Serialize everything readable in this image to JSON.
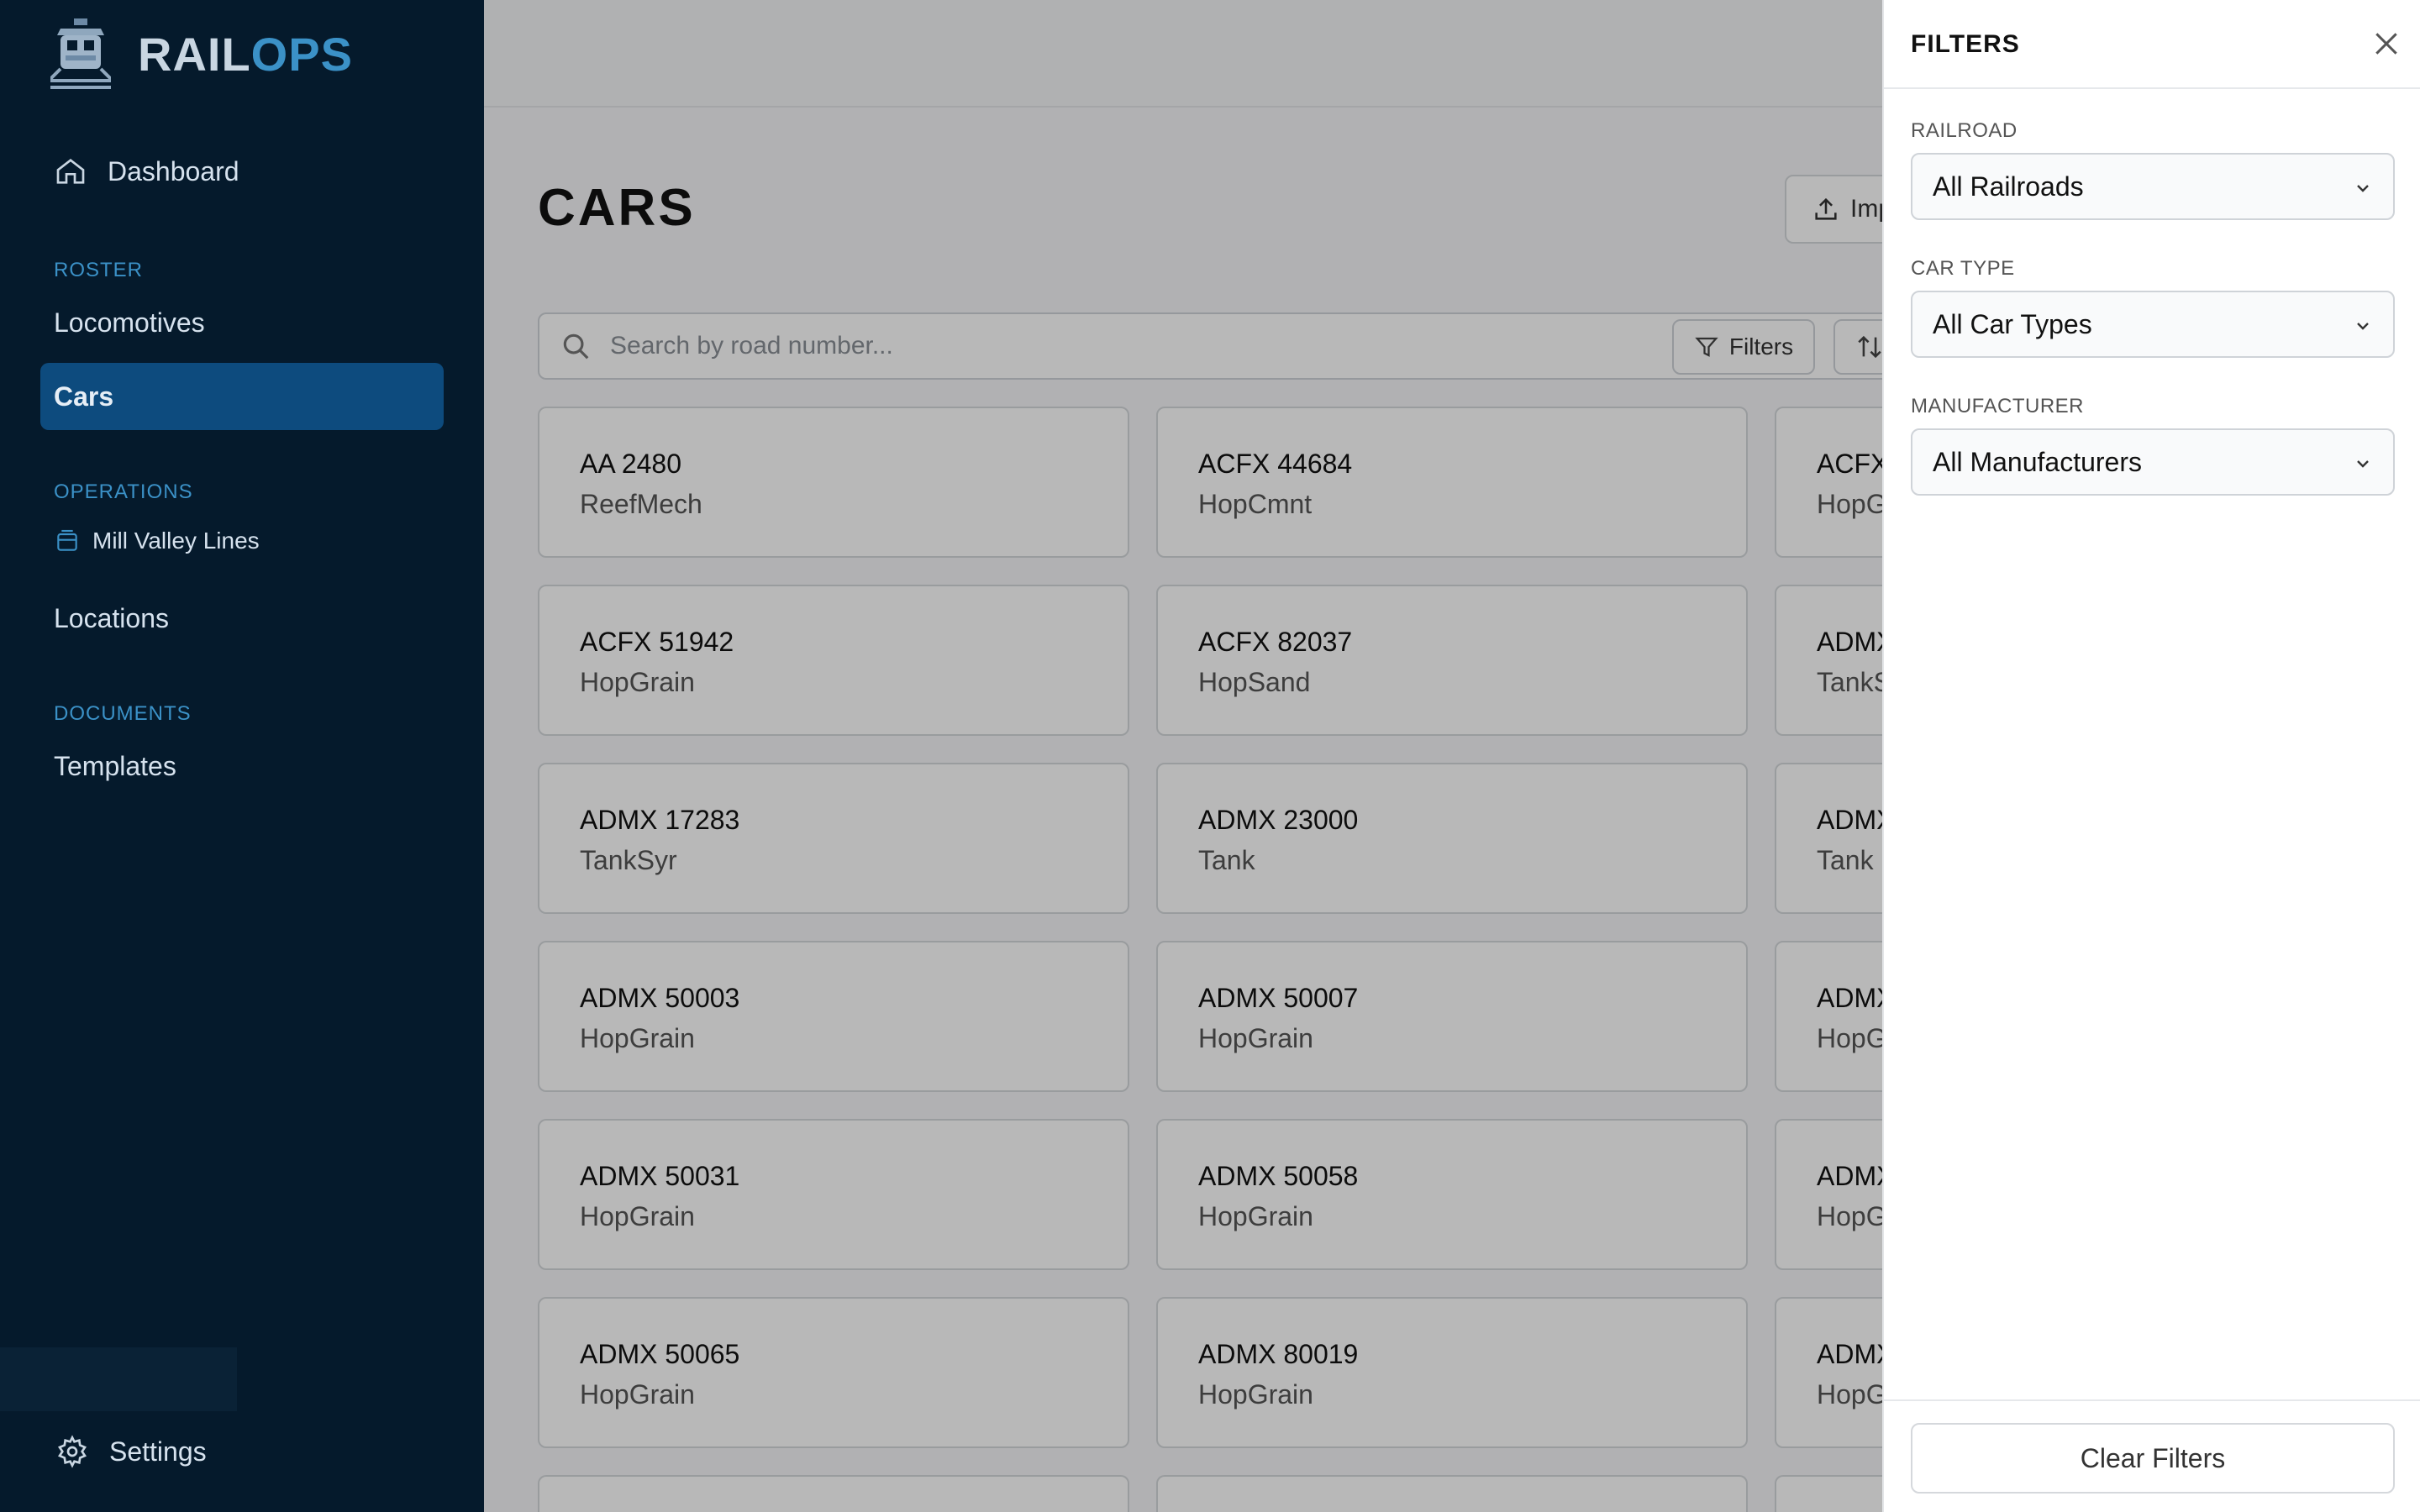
{
  "brand": {
    "part1": "RAIL",
    "part2": "OPS"
  },
  "sidebar": {
    "dashboard": "Dashboard",
    "roster_label": "ROSTER",
    "locomotives": "Locomotives",
    "cars": "Cars",
    "operations_label": "OPERATIONS",
    "layout": "Mill Valley Lines",
    "locations": "Locations",
    "documents_label": "DOCUMENTS",
    "templates": "Templates",
    "settings": "Settings"
  },
  "main": {
    "title": "CARS",
    "import_label": "Import",
    "search_placeholder": "Search by road number...",
    "filters_label": "Filters"
  },
  "cars": [
    {
      "road": "AA 2480",
      "type": "ReefMech"
    },
    {
      "road": "ACFX 44684",
      "type": "HopCmnt"
    },
    {
      "road": "ACFX",
      "type": "HopG"
    },
    {
      "road": "ACFX 51942",
      "type": "HopGrain"
    },
    {
      "road": "ACFX 82037",
      "type": "HopSand"
    },
    {
      "road": "ADMX",
      "type": "TankS"
    },
    {
      "road": "ADMX 17283",
      "type": "TankSyr"
    },
    {
      "road": "ADMX 23000",
      "type": "Tank"
    },
    {
      "road": "ADMX",
      "type": "Tank"
    },
    {
      "road": "ADMX 50003",
      "type": "HopGrain"
    },
    {
      "road": "ADMX 50007",
      "type": "HopGrain"
    },
    {
      "road": "ADMX",
      "type": "HopG"
    },
    {
      "road": "ADMX 50031",
      "type": "HopGrain"
    },
    {
      "road": "ADMX 50058",
      "type": "HopGrain"
    },
    {
      "road": "ADMX",
      "type": "HopG"
    },
    {
      "road": "ADMX 50065",
      "type": "HopGrain"
    },
    {
      "road": "ADMX 80019",
      "type": "HopGrain"
    },
    {
      "road": "ADMX",
      "type": "HopG"
    }
  ],
  "filters": {
    "title": "FILTERS",
    "railroad_label": "RAILROAD",
    "railroad_value": "All Railroads",
    "car_type_label": "CAR TYPE",
    "car_type_value": "All Car Types",
    "manufacturer_label": "MANUFACTURER",
    "manufacturer_value": "All Manufacturers",
    "clear_label": "Clear Filters"
  },
  "colors": {
    "sidebar_bg": "#051a2c",
    "accent": "#3b91c7",
    "active_item": "#0d4b7e"
  }
}
